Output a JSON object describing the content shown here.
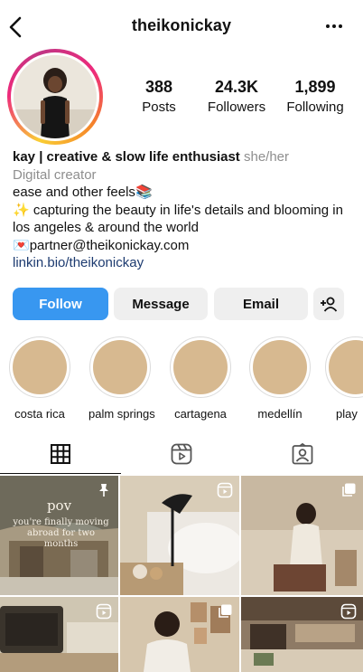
{
  "header": {
    "username": "theikonickay"
  },
  "stats": {
    "posts": {
      "value": "388",
      "label": "Posts"
    },
    "followers": {
      "value": "24.3K",
      "label": "Followers"
    },
    "following": {
      "value": "1,899",
      "label": "Following"
    }
  },
  "bio": {
    "name": "kay | creative & slow life enthusiast",
    "pronouns": "she/her",
    "category": "Digital creator",
    "line1": "ease and other feels",
    "line1_emoji": "📚",
    "line2_emoji": "✨",
    "line2": "capturing the beauty in life's details and blooming in los angeles & around the world",
    "email_emoji": "💌",
    "email": "partner@theikonickay.com",
    "link": "linkin.bio/theikonickay"
  },
  "actions": {
    "follow": "Follow",
    "message": "Message",
    "email": "Email"
  },
  "highlights": [
    {
      "label": "costa rica"
    },
    {
      "label": "palm springs"
    },
    {
      "label": "cartagena"
    },
    {
      "label": "medellín"
    },
    {
      "label": "play"
    }
  ],
  "posts": {
    "first": {
      "title": "pov",
      "subtitle": "you're finally moving abroad for two months"
    }
  },
  "colors": {
    "follow_button": "#3897f0",
    "secondary_button": "#efefef",
    "link": "#1d3b70"
  }
}
